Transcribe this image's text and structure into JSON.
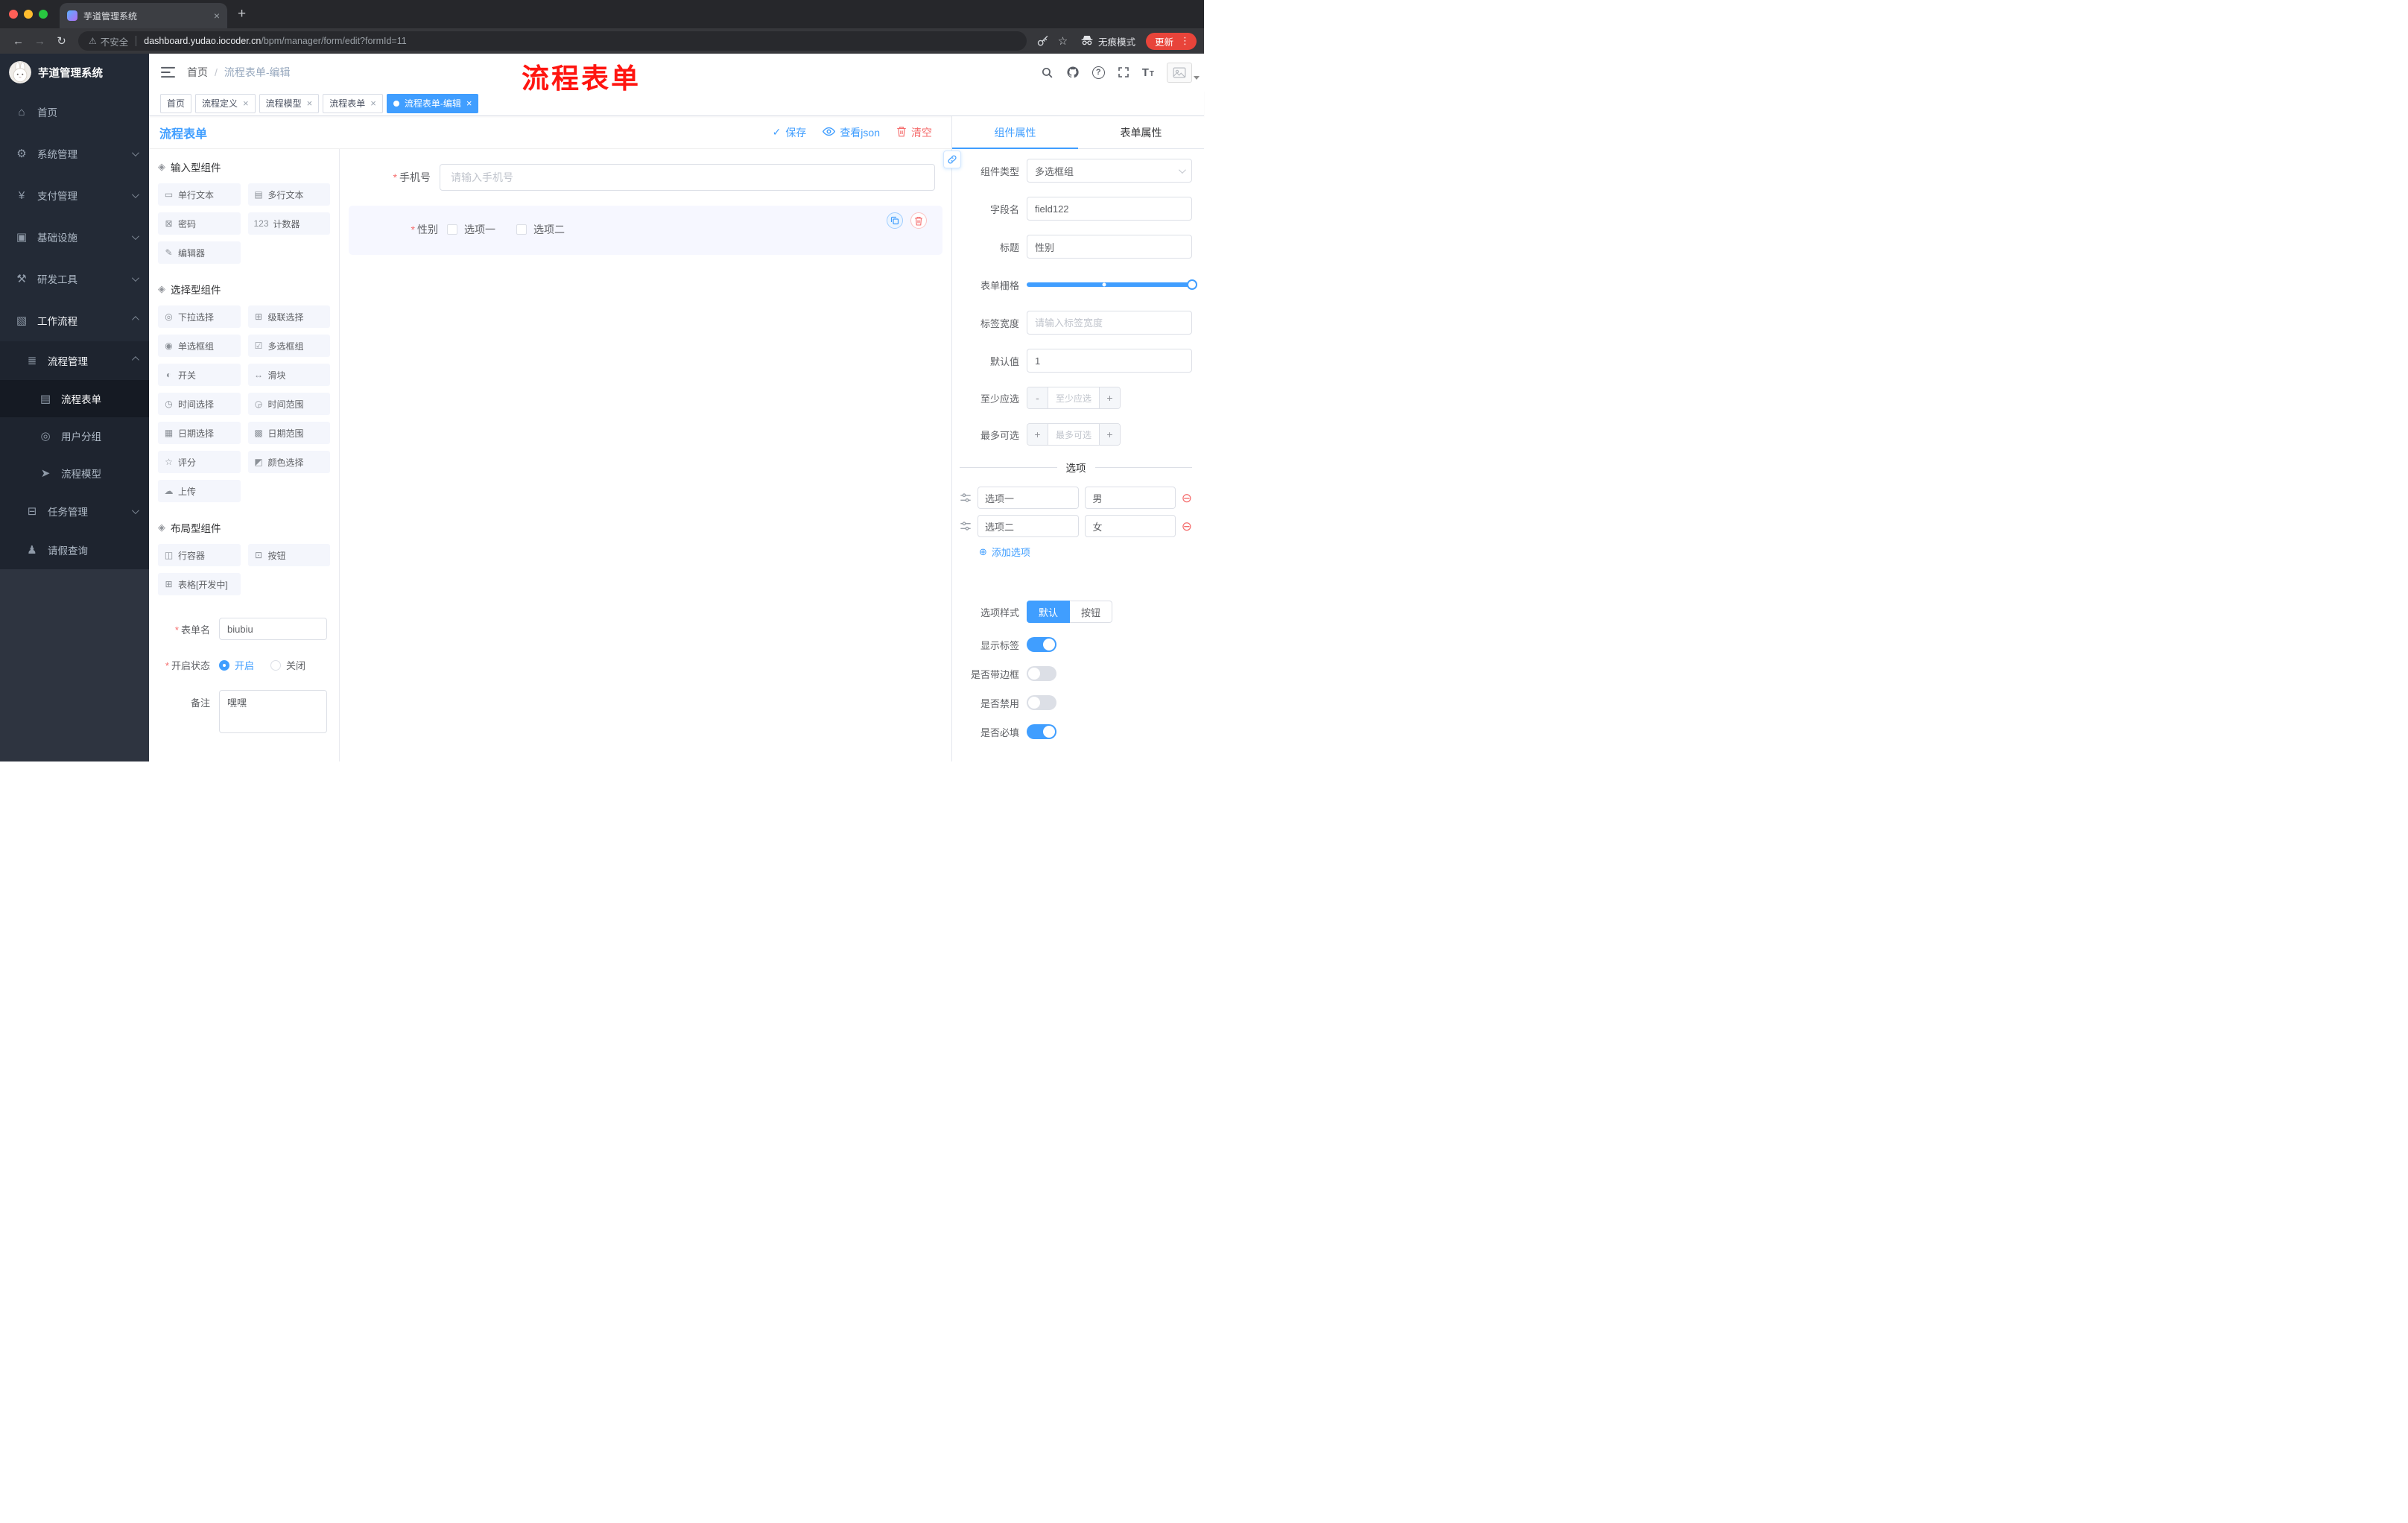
{
  "theme": {
    "accent": "#409eff",
    "danger": "#f56c6c",
    "annotation_red": "#ff1510",
    "tag_active": "#409eff"
  },
  "required_mark": "*",
  "annotation_text": "流程表单",
  "browser": {
    "tab_title": "芋道管理系统",
    "security_label": "不安全",
    "url_host": "dashboard.yudao.iocoder.cn",
    "url_path": "/bpm/manager/form/edit?formId=11",
    "incognito_label": "无痕模式",
    "update_label": "更新",
    "glyphs": {
      "back": "←",
      "forward": "→",
      "reload": "↻",
      "star": "☆",
      "warn": "⚠",
      "menu_dots": "⋮",
      "new_tab": "+",
      "close": "×"
    }
  },
  "header": {
    "breadcrumb_home": "首页",
    "breadcrumb_sep": "/",
    "breadcrumb_current": "流程表单-编辑",
    "help_glyph": "?",
    "font_icon_large": "T",
    "font_icon_small": "T"
  },
  "tag_close_glyph": "×",
  "tags": [
    {
      "label": "首页",
      "active": false,
      "closable": false
    },
    {
      "label": "流程定义",
      "active": false,
      "closable": true
    },
    {
      "label": "流程模型",
      "active": false,
      "closable": true
    },
    {
      "label": "流程表单",
      "active": false,
      "closable": true
    },
    {
      "label": "流程表单-编辑",
      "active": true,
      "closable": true
    }
  ],
  "sidebar": {
    "logo_title": "芋道管理系统",
    "menu": [
      {
        "label": "首页",
        "icon": "home-icon",
        "glyph": "⌂"
      },
      {
        "label": "系统管理",
        "icon": "gear-icon",
        "glyph": "⚙"
      },
      {
        "label": "支付管理",
        "icon": "payment-icon",
        "glyph": "¥"
      },
      {
        "label": "基础设施",
        "icon": "infrastructure-icon",
        "glyph": "▣"
      },
      {
        "label": "研发工具",
        "icon": "dev-tools-icon",
        "glyph": "⚒"
      },
      {
        "label": "工作流程",
        "icon": "workflow-icon",
        "glyph": "▧"
      },
      {
        "label": "流程管理",
        "icon": "process-manage-icon",
        "glyph": "≣"
      },
      {
        "label": "流程表单",
        "icon": "process-form-icon",
        "glyph": "▤"
      },
      {
        "label": "用户分组",
        "icon": "user-group-icon",
        "glyph": "◎"
      },
      {
        "label": "流程模型",
        "icon": "process-model-icon",
        "glyph": "➤"
      },
      {
        "label": "任务管理",
        "icon": "task-manage-icon",
        "glyph": "⊟"
      },
      {
        "label": "请假查询",
        "icon": "leave-query-icon",
        "glyph": "♟"
      }
    ]
  },
  "toolbar": {
    "title": "流程表单",
    "save_label": "保存",
    "save_glyph": "✓",
    "view_json_label": "查看json",
    "clear_label": "清空"
  },
  "palette": {
    "section_icon": "◈",
    "sections": [
      {
        "title": "输入型组件",
        "items": [
          {
            "label": "单行文本",
            "glyph": "▭"
          },
          {
            "label": "多行文本",
            "glyph": "▤"
          },
          {
            "label": "密码",
            "glyph": "⊠"
          },
          {
            "label": "计数器",
            "glyph": "123"
          },
          {
            "label": "编辑器",
            "glyph": "✎"
          }
        ]
      },
      {
        "title": "选择型组件",
        "items": [
          {
            "label": "下拉选择",
            "glyph": "◎"
          },
          {
            "label": "级联选择",
            "glyph": "⊞"
          },
          {
            "label": "单选框组",
            "glyph": "◉"
          },
          {
            "label": "多选框组",
            "glyph": "☑"
          },
          {
            "label": "开关",
            "glyph": "◐"
          },
          {
            "label": "滑块",
            "glyph": "↔"
          },
          {
            "label": "时间选择",
            "glyph": "◷"
          },
          {
            "label": "时间范围",
            "glyph": "◶"
          },
          {
            "label": "日期选择",
            "glyph": "▦"
          },
          {
            "label": "日期范围",
            "glyph": "▩"
          },
          {
            "label": "评分",
            "glyph": "☆"
          },
          {
            "label": "颜色选择",
            "glyph": "◩"
          },
          {
            "label": "上传",
            "glyph": "☁"
          }
        ]
      },
      {
        "title": "布局型组件",
        "items": [
          {
            "label": "行容器",
            "glyph": "◫"
          },
          {
            "label": "按钮",
            "glyph": "⊡"
          },
          {
            "label": "表格[开发中]",
            "glyph": "⊞"
          }
        ]
      }
    ],
    "form": {
      "name_label": "表单名",
      "name_value": "biubiu",
      "status_label": "开启状态",
      "status_on": "开启",
      "status_off": "关闭",
      "remark_label": "备注",
      "remark_value": "嘿嘿"
    }
  },
  "canvas": {
    "phone_label": "手机号",
    "phone_placeholder": "请输入手机号",
    "gender_label": "性别",
    "gender_options": [
      "选项一",
      "选项二"
    ]
  },
  "props": {
    "tab_component": "组件属性",
    "tab_form": "表单属性",
    "rows": {
      "component_type": {
        "label": "组件类型",
        "value": "多选框组"
      },
      "field_name": {
        "label": "字段名",
        "value": "field122"
      },
      "title": {
        "label": "标题",
        "value": "性别"
      },
      "grid": {
        "label": "表单栅格"
      },
      "label_width": {
        "label": "标签宽度",
        "placeholder": "请输入标签宽度"
      },
      "default_value": {
        "label": "默认值",
        "value": "1"
      },
      "min_select": {
        "label": "至少应选",
        "placeholder": "至少应选"
      },
      "max_select": {
        "label": "最多可选",
        "placeholder": "最多可选"
      }
    },
    "stepper_minus": "-",
    "stepper_plus": "+",
    "options_divider": "选项",
    "options": [
      {
        "label": "选项一",
        "value": "男"
      },
      {
        "label": "选项二",
        "value": "女"
      }
    ],
    "remove_glyph": "⊖",
    "add_glyph": "⊕",
    "add_option_label": "添加选项",
    "style_row": {
      "label": "选项样式",
      "option_default": "默认",
      "option_button": "按钮",
      "selected": "默认"
    },
    "switch_rows": [
      {
        "label": "显示标签",
        "on": true
      },
      {
        "label": "是否带边框",
        "on": false
      },
      {
        "label": "是否禁用",
        "on": false
      },
      {
        "label": "是否必填",
        "on": true
      }
    ]
  }
}
